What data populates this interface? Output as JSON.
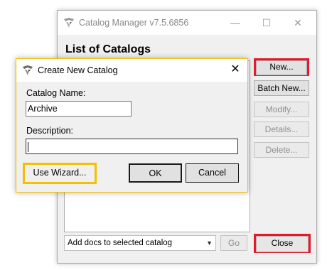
{
  "main_window": {
    "title": "Catalog Manager v7.5.6856",
    "controls": {
      "minimize": "—",
      "maximize": "☐",
      "close": "✕"
    },
    "heading": "List of Catalogs",
    "side_buttons": {
      "new": "New...",
      "batch_new": "Batch New...",
      "modify": "Modify...",
      "details": "Details...",
      "delete": "Delete..."
    },
    "bottom": {
      "combo_value": "Add docs to selected catalog",
      "go": "Go",
      "close": "Close"
    }
  },
  "dialog": {
    "title": "Create New Catalog",
    "close_glyph": "✕",
    "catalog_name_label": "Catalog Name:",
    "catalog_name_value": "Archive",
    "description_label": "Description:",
    "description_value": "",
    "buttons": {
      "wizard": "Use Wizard...",
      "ok": "OK",
      "cancel": "Cancel"
    }
  },
  "colors": {
    "highlight_red": "#e8172b",
    "highlight_yellow": "#f5c000"
  }
}
